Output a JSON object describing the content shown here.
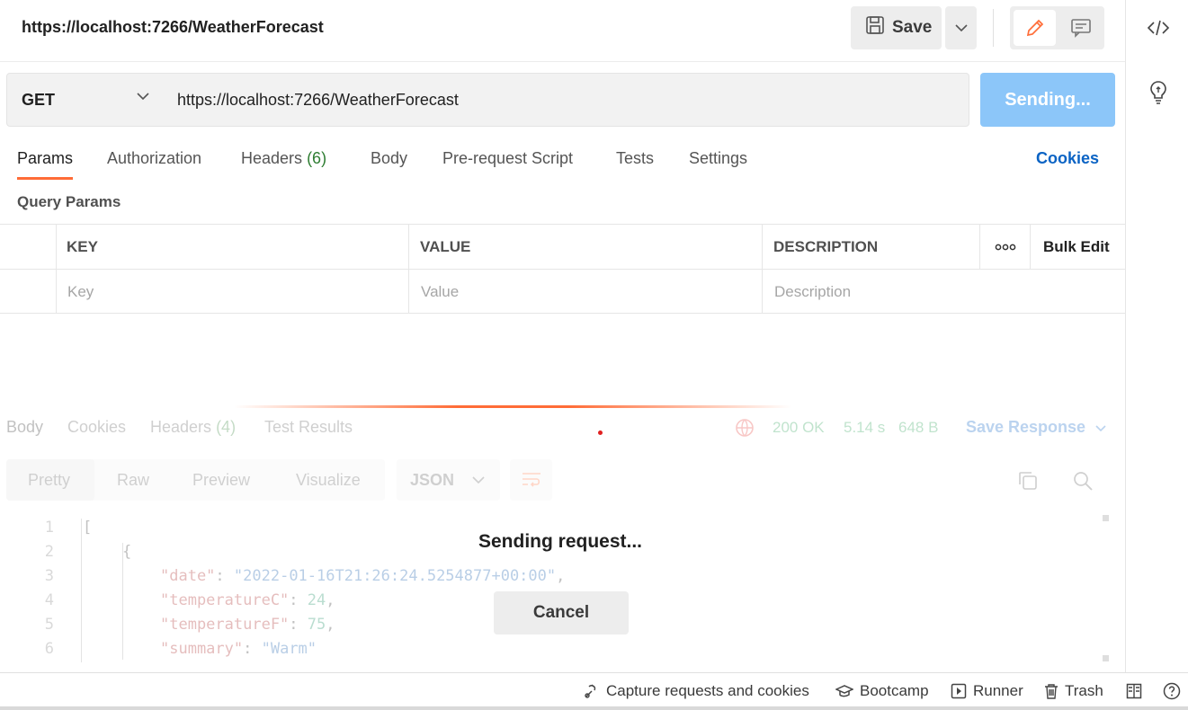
{
  "header": {
    "request_title": "https://localhost:7266/WeatherForecast",
    "save_label": "Save"
  },
  "request": {
    "method": "GET",
    "url": "https://localhost:7266/WeatherForecast",
    "send_label": "Sending..."
  },
  "request_tabs": {
    "params": "Params",
    "authorization": "Authorization",
    "headers": "Headers",
    "headers_count": "(6)",
    "body": "Body",
    "pre_request": "Pre-request Script",
    "tests": "Tests",
    "settings": "Settings",
    "cookies": "Cookies"
  },
  "query_params": {
    "title": "Query Params",
    "columns": {
      "key": "KEY",
      "value": "VALUE",
      "description": "DESCRIPTION",
      "bulk_edit": "Bulk Edit"
    },
    "placeholders": {
      "key": "Key",
      "value": "Value",
      "description": "Description"
    }
  },
  "response": {
    "tabs": {
      "body": "Body",
      "cookies": "Cookies",
      "headers": "Headers",
      "headers_count": "(4)",
      "test_results": "Test Results"
    },
    "status": "200 OK",
    "time": "5.14 s",
    "size": "648 B",
    "save_response": "Save Response",
    "views": {
      "pretty": "Pretty",
      "raw": "Raw",
      "preview": "Preview",
      "visualize": "Visualize"
    },
    "format": "JSON",
    "code": {
      "line_numbers": [
        "1",
        "2",
        "3",
        "4",
        "5",
        "6"
      ],
      "l1": "[",
      "l2": "{",
      "l3_key": "\"date\"",
      "l3_val": "\"2022-01-16T21:26:24.5254877+00:00\"",
      "l4_key": "\"temperatureC\"",
      "l4_val": "24",
      "l5_key": "\"temperatureF\"",
      "l5_val": "75",
      "l6_key": "\"summary\"",
      "l6_val": "\"Warm\""
    }
  },
  "overlay": {
    "message": "Sending request...",
    "cancel_label": "Cancel"
  },
  "footer": {
    "capture": "Capture requests and cookies",
    "bootcamp": "Bootcamp",
    "runner": "Runner",
    "trash": "Trash"
  },
  "colors": {
    "accent_orange": "#ff6c37",
    "send_blue_disabled": "#8cc6f9",
    "link_blue": "#0b63c4",
    "status_green": "#1e9b4b"
  }
}
